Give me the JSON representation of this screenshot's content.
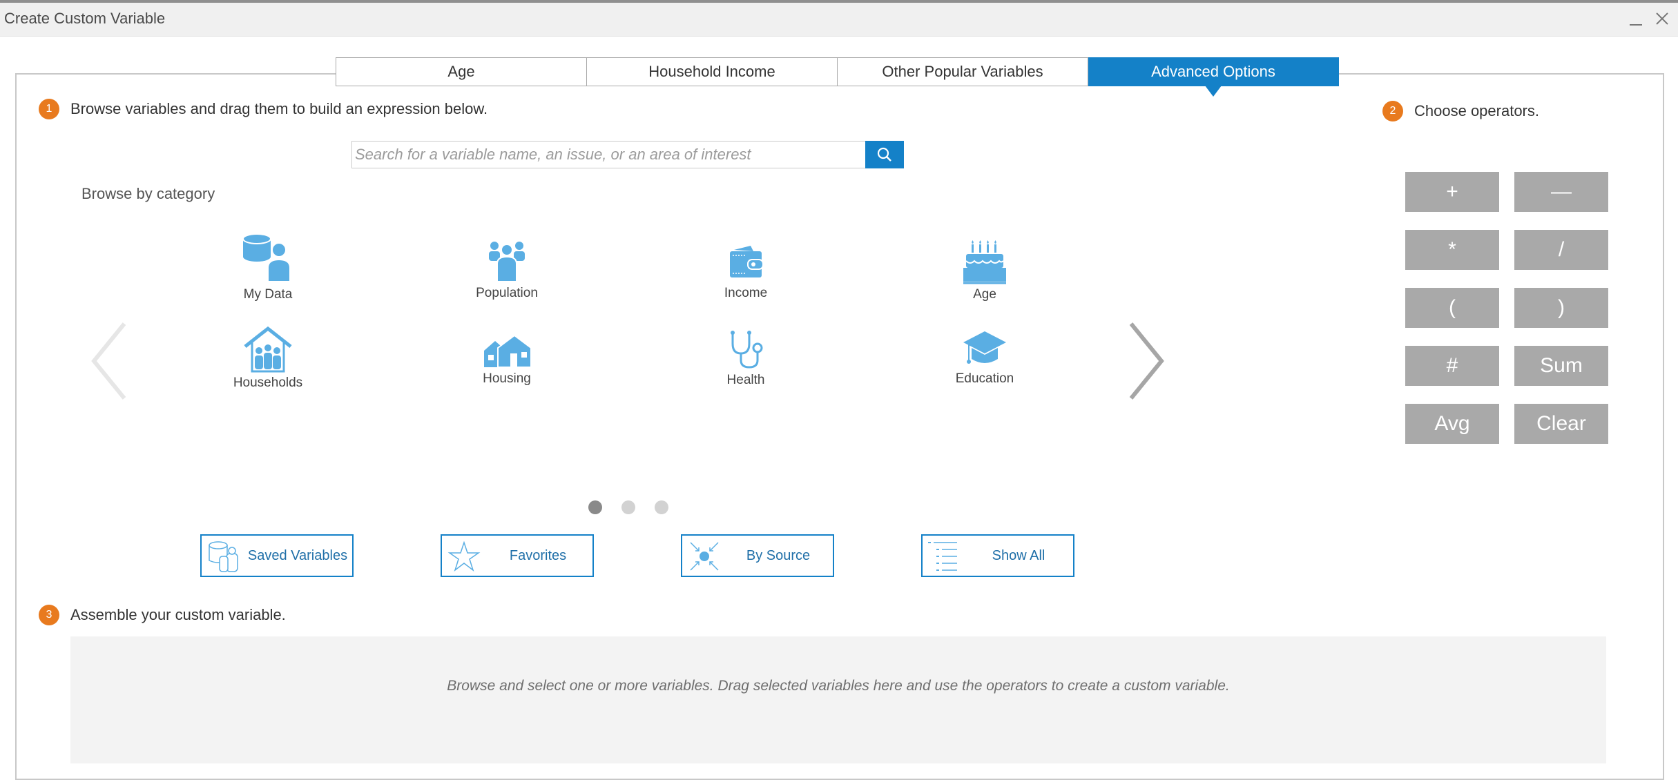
{
  "window": {
    "title": "Create Custom Variable",
    "minimize_icon": "minimize-icon",
    "close_icon": "close-icon"
  },
  "tabs": [
    {
      "label": "Age",
      "active": false
    },
    {
      "label": "Household Income",
      "active": false
    },
    {
      "label": "Other Popular Variables",
      "active": false
    },
    {
      "label": "Advanced Options",
      "active": true
    }
  ],
  "step1": {
    "number": "1",
    "text": "Browse variables and drag them to build an expression below."
  },
  "step2": {
    "number": "2",
    "text": "Choose operators."
  },
  "step3": {
    "number": "3",
    "text": "Assemble your custom variable."
  },
  "search": {
    "placeholder": "Search for a variable name, an issue, or an area of interest",
    "value": "",
    "icon": "search-icon"
  },
  "browse": {
    "label": "Browse by category",
    "categories": [
      {
        "label": "My Data",
        "icon": "my-data-icon"
      },
      {
        "label": "Population",
        "icon": "population-icon"
      },
      {
        "label": "Income",
        "icon": "income-icon"
      },
      {
        "label": "Age",
        "icon": "age-icon"
      },
      {
        "label": "Households",
        "icon": "households-icon"
      },
      {
        "label": "Housing",
        "icon": "housing-icon"
      },
      {
        "label": "Health",
        "icon": "health-icon"
      },
      {
        "label": "Education",
        "icon": "education-icon"
      }
    ],
    "pages": 3,
    "current_page": 1
  },
  "quick_buttons": [
    {
      "label": "Saved Variables",
      "icon": "saved-variables-icon"
    },
    {
      "label": "Favorites",
      "icon": "star-icon"
    },
    {
      "label": "By Source",
      "icon": "by-source-icon"
    },
    {
      "label": "Show All",
      "icon": "list-icon"
    }
  ],
  "operators": [
    "+",
    "—",
    "*",
    "/",
    "(",
    ")",
    "#",
    "Sum",
    "Avg",
    "Clear"
  ],
  "dropzone": {
    "text": "Browse and select one or more variables. Drag selected variables here and use the operators to create a custom variable."
  },
  "colors": {
    "accent": "#1481c8",
    "step_badge": "#e87a1e",
    "icon_blue": "#5aaee3",
    "operator_gray": "#a9a9a9"
  }
}
